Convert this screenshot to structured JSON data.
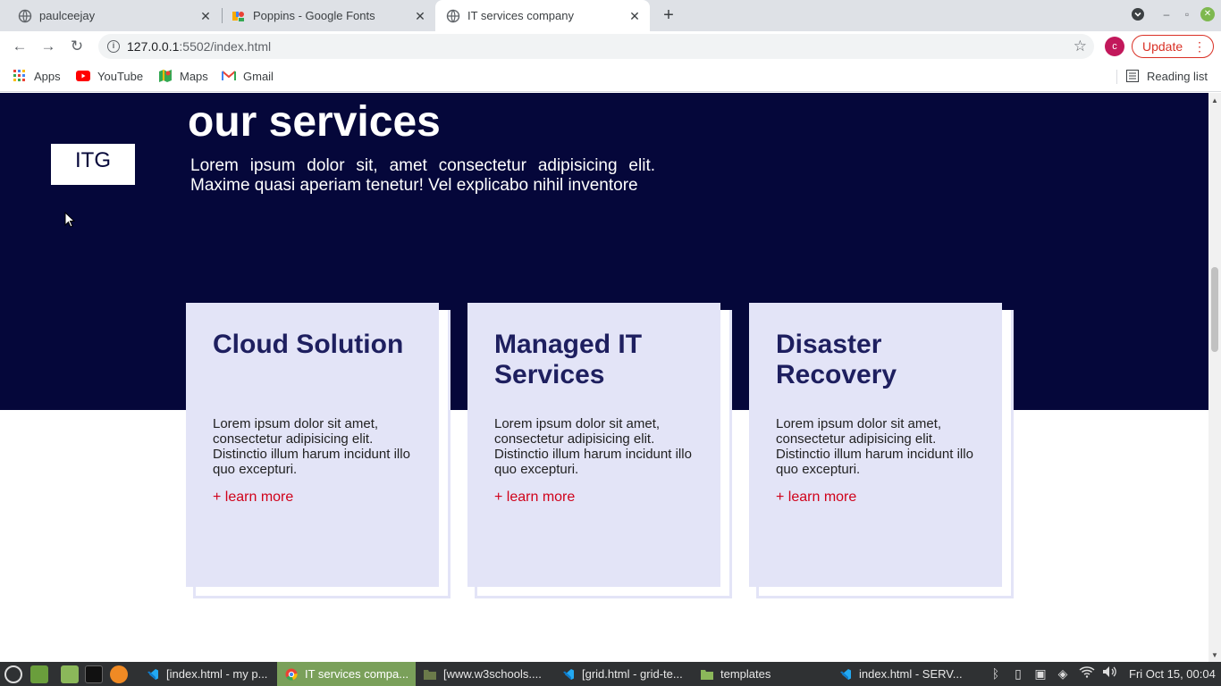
{
  "browser": {
    "tabs": [
      {
        "title": "paulceejay",
        "icon": "globe-icon",
        "close_label": "✕"
      },
      {
        "title": "Poppins - Google Fonts",
        "icon": "google-fonts-icon",
        "close_label": "✕"
      },
      {
        "title": "IT services company",
        "icon": "globe-icon",
        "close_label": "✕"
      }
    ],
    "new_tab_label": "+",
    "window_controls": {
      "minimize": "–",
      "maximize": "▫",
      "close": "✕"
    },
    "nav": {
      "back": "←",
      "forward": "→",
      "reload": "↻"
    },
    "url_host": "127.0.0.1",
    "url_path": ":5502/index.html",
    "star": "☆",
    "profile_initial": "c",
    "update_label": "Update",
    "update_menu": "⋮",
    "bookmarks": [
      {
        "label": "Apps",
        "icon": "apps-grid-icon"
      },
      {
        "label": "YouTube",
        "icon": "youtube-icon"
      },
      {
        "label": "Maps",
        "icon": "maps-icon"
      },
      {
        "label": "Gmail",
        "icon": "gmail-icon"
      }
    ],
    "reading_list": "Reading list"
  },
  "page": {
    "logo": "ITG",
    "hero_title": "our services",
    "hero_text": "Lorem ipsum dolor sit, amet consectetur adipisicing elit. Maxime quasi aperiam tenetur! Vel explicabo nihil inventore",
    "cards": [
      {
        "title": "Cloud Solution",
        "text": "Lorem ipsum dolor sit amet, consectetur adipisicing elit. Distinctio illum harum incidunt illo quo excepturi.",
        "link": "+ learn more"
      },
      {
        "title": "Managed IT Services",
        "text": "Lorem ipsum dolor sit amet, consectetur adipisicing elit. Distinctio illum harum incidunt illo quo excepturi.",
        "link": "+ learn more"
      },
      {
        "title": "Disaster Recovery",
        "text": "Lorem ipsum dolor sit amet, consectetur adipisicing elit. Distinctio illum harum incidunt illo quo excepturi.",
        "link": "+ learn more"
      }
    ],
    "colors": {
      "hero_bg": "#05073a",
      "card_bg": "#e3e4f7",
      "card_title": "#1e1f5f",
      "link": "#d0021b"
    }
  },
  "taskbar": {
    "items": [
      {
        "label": "[index.html - my p...",
        "icon": "vscode-icon"
      },
      {
        "label": "IT services compa...",
        "icon": "chrome-icon"
      },
      {
        "label": "[www.w3schools....",
        "icon": "folder-icon"
      },
      {
        "label": "[grid.html - grid-te...",
        "icon": "vscode-icon"
      },
      {
        "label": "templates",
        "icon": "folder-icon"
      },
      {
        "label": "index.html - SERV...",
        "icon": "vscode-icon"
      }
    ],
    "clock": "Fri Oct 15, 00:04"
  }
}
